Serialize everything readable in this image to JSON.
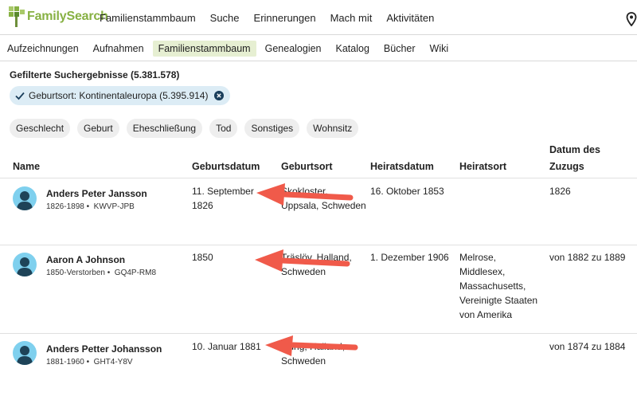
{
  "header": {
    "logo_text": "FamilySearch",
    "nav": [
      "Familienstammbaum",
      "Suche",
      "Erinnerungen",
      "Mach mit",
      "Aktivitäten"
    ]
  },
  "subnav": {
    "items": [
      "Aufzeichnungen",
      "Aufnahmen",
      "Familienstammbaum",
      "Genealogien",
      "Katalog",
      "Bücher",
      "Wiki"
    ],
    "active": "Familienstammbaum"
  },
  "results": {
    "title": "Gefilterte Suchergebnisse (5.381.578)",
    "active_filter": "Geburtsort: Kontinentaleuropa (5.395.914)",
    "filters": [
      "Geschlecht",
      "Geburt",
      "Eheschließung",
      "Tod",
      "Sonstiges",
      "Wohnsitz"
    ]
  },
  "table": {
    "headers": {
      "name": "Name",
      "birth_date": "Geburtsdatum",
      "birth_place": "Geburtsort",
      "marriage_date": "Heiratsdatum",
      "marriage_place": "Heiratsort",
      "move_date_line1": "Datum des",
      "move_date_line2": "Zuzugs"
    },
    "rows": [
      {
        "name": "Anders Peter Jansson",
        "life": "1826-1898",
        "id": "KWVP-JPB",
        "birth_date_l1": "11. September",
        "birth_date_l2": "1826",
        "birth_place_l1": "Skokloster,",
        "birth_place_l2": "Uppsala, Schweden",
        "marriage_date": "16. Oktober 1853",
        "marriage_place": [
          "",
          "",
          "",
          "",
          ""
        ],
        "move_date": "1826"
      },
      {
        "name": "Aaron A Johnson",
        "life": "1850-Verstorben",
        "id": "GQ4P-RM8",
        "birth_date_l1": "1850",
        "birth_date_l2": "",
        "birth_place_l1": "Träslöv, Halland,",
        "birth_place_l2": "Schweden",
        "marriage_date": "1. Dezember 1906",
        "marriage_place": [
          "Melrose,",
          "Middlesex,",
          "Massachusetts,",
          "Vereinigte Staaten",
          "von Amerika"
        ],
        "move_date": "von 1882 zu 1889"
      },
      {
        "name": "Anders Petter Johansson",
        "life": "1881-1960",
        "id": "GHT4-Y8V",
        "birth_date_l1": "10. Januar 1881",
        "birth_date_l2": "",
        "birth_place_l1": "Ljung, Halland,",
        "birth_place_l2": "Schweden",
        "marriage_date": "",
        "marriage_place": [
          "",
          "",
          "",
          "",
          ""
        ],
        "move_date": "von 1874 zu 1884"
      }
    ]
  },
  "colors": {
    "brand_green": "#87b143",
    "active_tab_bg": "#e6efd2",
    "chip_blue": "#dcecf5",
    "annotation_arrow": "#f05a4a"
  }
}
